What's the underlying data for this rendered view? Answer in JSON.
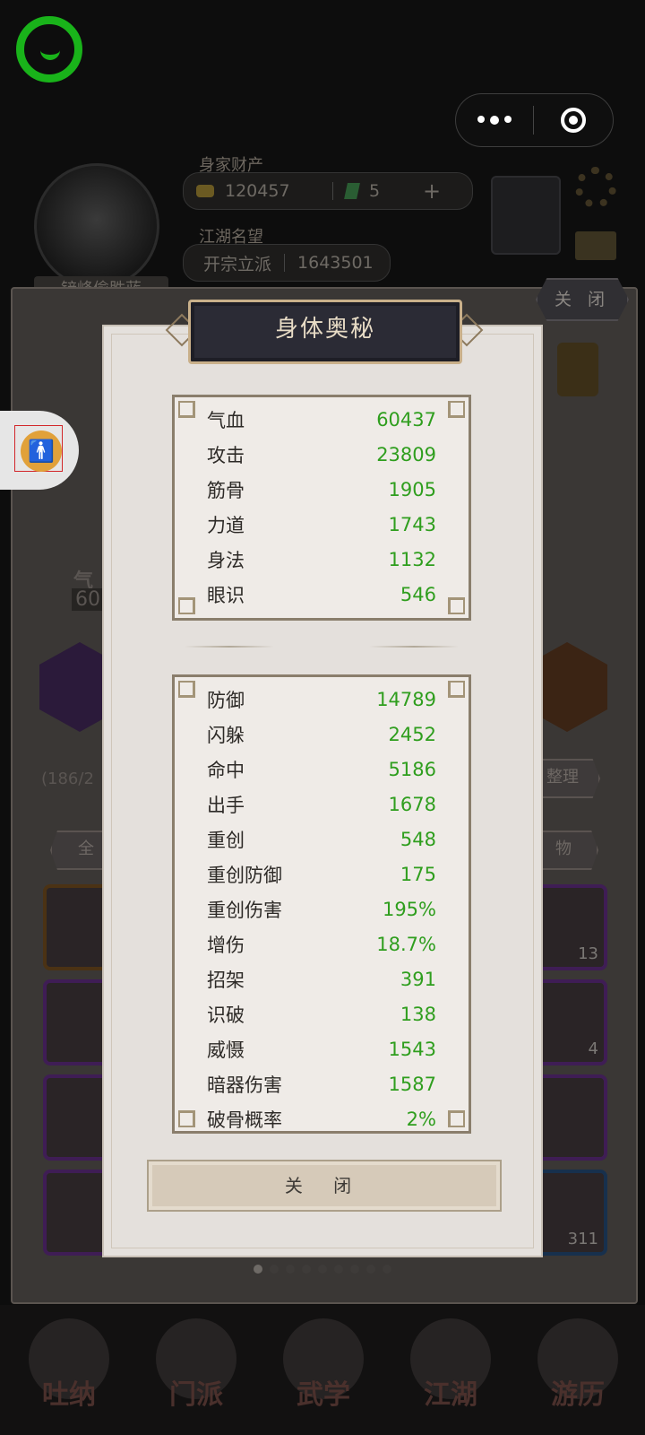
{
  "header": {
    "wealth_label": "身家财产",
    "coins": "120457",
    "gems": "5",
    "plus": "+",
    "fame_label": "江湖名望",
    "fame_rank": "开宗立派",
    "fame_value": "1643501",
    "player_name": "铲峰偷胜蓝",
    "top_close": "关 闭"
  },
  "background": {
    "partial_stat_label": "气",
    "partial_stat_value": "60",
    "bag_count": "(186/2",
    "sort_label": "整理",
    "tab_all": "全",
    "tab_items": "物",
    "slot_counts": [
      "13",
      "4",
      "311"
    ]
  },
  "modal": {
    "title": "身体奥秘",
    "basic_stats": [
      {
        "label": "气血",
        "value": "60437"
      },
      {
        "label": "攻击",
        "value": "23809"
      },
      {
        "label": "筋骨",
        "value": "1905"
      },
      {
        "label": "力道",
        "value": "1743"
      },
      {
        "label": "身法",
        "value": "1132"
      },
      {
        "label": "眼识",
        "value": "546"
      }
    ],
    "combat_stats": [
      {
        "label": "防御",
        "value": "14789"
      },
      {
        "label": "闪躲",
        "value": "2452"
      },
      {
        "label": "命中",
        "value": "5186"
      },
      {
        "label": "出手",
        "value": "1678"
      },
      {
        "label": "重创",
        "value": "548"
      },
      {
        "label": "重创防御",
        "value": "175"
      },
      {
        "label": "重创伤害",
        "value": "195%"
      },
      {
        "label": "增伤",
        "value": "18.7%"
      },
      {
        "label": "招架",
        "value": "391"
      },
      {
        "label": "识破",
        "value": "138"
      },
      {
        "label": "威慑",
        "value": "1543"
      },
      {
        "label": "暗器伤害",
        "value": "1587"
      },
      {
        "label": "破骨概率",
        "value": "2%"
      }
    ],
    "close_label": "关 闭"
  },
  "pager": {
    "total": 9,
    "active": 0
  },
  "bottom_nav": [
    "吐纳",
    "门派",
    "武学",
    "江湖",
    "游历"
  ],
  "colors": {
    "stat_value": "#2f9e1e",
    "logo_green": "#19b31a",
    "title_plate": "#2b2b35"
  }
}
